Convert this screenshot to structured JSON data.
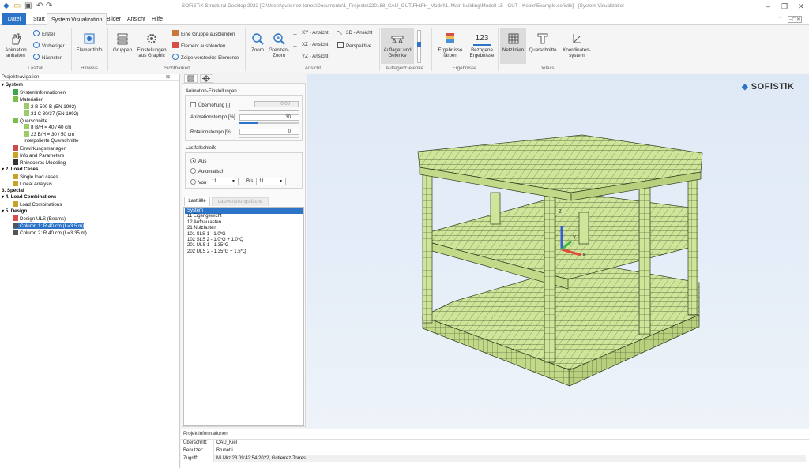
{
  "titlebar": {
    "title": "SOFiSTiK Structural Desktop 2022 [C:\\Users\\gutierrez-torres\\Documents\\1_Projects\\220188_CAU_GUT\\FH\\FH_Model\\1. Main building\\Modell 15 - GUT - Kopie\\Example.sofistik] - [System Visualization]",
    "window_controls": [
      "–",
      "❐",
      "✕"
    ]
  },
  "menubar": {
    "tabs": [
      "Datei",
      "Start",
      "System Visualization",
      "Bilder",
      "Ansicht",
      "Hilfe"
    ]
  },
  "ribbon": {
    "animation_label": "Animation anhalten",
    "erster": "Erster",
    "vorheriger": "Vorheriger",
    "naechster": "Nächster",
    "lastfall_group": "Lastfall",
    "elementinfo": "ElementInfo",
    "hinweis_group": "Hinweis",
    "gruppen": "Gruppen",
    "einstellungen": "Einstellungen aus Graphic",
    "gruppe_ausblenden": "Eine Gruppe ausblenden",
    "element_ausblenden": "Element ausblenden",
    "zeige_versteckte": "Zeige versteckte Elemente",
    "sichtbarkeit_group": "Sichtbarkeit",
    "zoom": "Zoom",
    "grenzen_zoom": "Grenzen-Zoom",
    "xy_ansicht": "XY - Ansicht",
    "xz_ansicht": "XZ - Ansicht",
    "yz_ansicht": "YZ - Ansicht",
    "ansicht_3d": "3D - Ansicht",
    "perspektive": "Perspektive",
    "ansicht_group": "Ansicht",
    "auflager": "Auflager und Gelenke",
    "auflager_group": "Auflager/Gelenke",
    "ergebnisse_faerben": "Ergebnisse färben",
    "bezogene_ergebnisse": "Bezogene Ergebnisse",
    "bezogene_icon_text": "123",
    "ergebnisse_group": "Ergebnisse",
    "netzlinien": "Netzlinien",
    "querschnitte": "Querschnitte",
    "koordinatensystem": "Koordinaten-system",
    "details_group": "Details"
  },
  "project_nav": {
    "header": "Projektnavigation",
    "items": [
      {
        "label": "System",
        "bold": true,
        "indent": 0,
        "icon": "expand-icon"
      },
      {
        "label": "Systeminformationen",
        "bold": false,
        "indent": 2,
        "icon": "system-info-icon"
      },
      {
        "label": "Materialien",
        "bold": false,
        "indent": 2,
        "icon": "materials-icon"
      },
      {
        "label": "2 B 500 B (EN 1992)",
        "bold": false,
        "indent": 4,
        "icon": "material-item-icon"
      },
      {
        "label": "21 C 30/37 (EN 1992)",
        "bold": false,
        "indent": 4,
        "icon": "material-item-icon"
      },
      {
        "label": "Querschnitte",
        "bold": false,
        "indent": 2,
        "icon": "sections-icon"
      },
      {
        "label": "8 B/H = 40 / 40 cm",
        "bold": false,
        "indent": 4,
        "icon": "section-item-icon"
      },
      {
        "label": "23 B/H = 30 / 50 cm",
        "bold": false,
        "indent": 4,
        "icon": "section-item-icon"
      },
      {
        "label": "Interpolierte Querschnitte",
        "bold": false,
        "indent": 4,
        "icon": ""
      },
      {
        "label": "Einwirkungsmanager",
        "bold": false,
        "indent": 2,
        "icon": "action-manager-icon"
      },
      {
        "label": "Info and Parameters",
        "bold": false,
        "indent": 2,
        "icon": "info-parameters-icon"
      },
      {
        "label": "Rhinoceros Modeling",
        "bold": false,
        "indent": 2,
        "icon": "rhino-icon"
      },
      {
        "label": "2. Load Cases",
        "bold": true,
        "indent": 0,
        "icon": "expand-icon"
      },
      {
        "label": "Single load cases",
        "bold": false,
        "indent": 2,
        "icon": "loadcase-icon"
      },
      {
        "label": "Lineal Analysis",
        "bold": false,
        "indent": 2,
        "icon": "loadcase-icon"
      },
      {
        "label": "3. Special",
        "bold": true,
        "indent": 0,
        "icon": ""
      },
      {
        "label": "4. Load Combinations",
        "bold": true,
        "indent": 0,
        "icon": "expand-icon"
      },
      {
        "label": "Load Combinations",
        "bold": false,
        "indent": 2,
        "icon": "loadcase-icon"
      },
      {
        "label": "5. Design",
        "bold": true,
        "indent": 0,
        "icon": "expand-icon"
      },
      {
        "label": "Design ULS (Beams)",
        "bold": false,
        "indent": 2,
        "icon": "beam-design-icon"
      },
      {
        "label": "Column 1: R 40 cm (L=3.5 m)",
        "bold": false,
        "indent": 2,
        "icon": "column-icon",
        "selected": true
      },
      {
        "label": "Column 2: R 40 cm (L=3.35 m)",
        "bold": false,
        "indent": 2,
        "icon": "column-icon"
      }
    ]
  },
  "animation": {
    "section_title": "Animation-Einstellungen",
    "ueberhoehung_label": "Überhöhung [-]",
    "ueberhoehung_value": "0.00",
    "tempo_label": "Animationstempo [%]",
    "tempo_value": "30",
    "tempo_level": 0.3,
    "rotation_label": "Rotationstempo [%]",
    "rotation_value": "0"
  },
  "lastfallschleife": {
    "title": "Lastfallschleife",
    "aus": "Aus",
    "automatisch": "Automatisch",
    "von_label": "Von",
    "von_value": "11",
    "bis_label": "Bis",
    "bis_value": "11"
  },
  "lastfaelle": {
    "tab_active": "Lastfälle",
    "tab_inactive": "Lastverteilungsfläche",
    "items": [
      "System",
      "11 Eigengewicht",
      "12 Aufbaulasten",
      "21 Nutzlasten",
      "101 SLS 1 - 1.0*G",
      "102 SLS 2 - 1.0*G + 1.0*Q",
      "201 ULS 1 - 1.35*G",
      "202 ULS 2 - 1.35*G + 1.5*Q"
    ]
  },
  "viewport": {
    "logo_text": "SOFiSTiK",
    "axis_z": "Z",
    "axis_x": "X",
    "axis_y": "Y",
    "model_color": "#cfe59a"
  },
  "project_info": {
    "title": "Projektinformationen",
    "rows": [
      {
        "key": "Überschrift:",
        "value": "CAU_Kiel"
      },
      {
        "key": "Benutzer:",
        "value": "Brunetti"
      },
      {
        "key": "Zugriff:",
        "value": "Mi Mrz 23 09:42:54 2022, Gutierrez-Torres"
      }
    ]
  },
  "colors": {
    "accent": "#2b74c7",
    "selection": "#2b74c7"
  }
}
